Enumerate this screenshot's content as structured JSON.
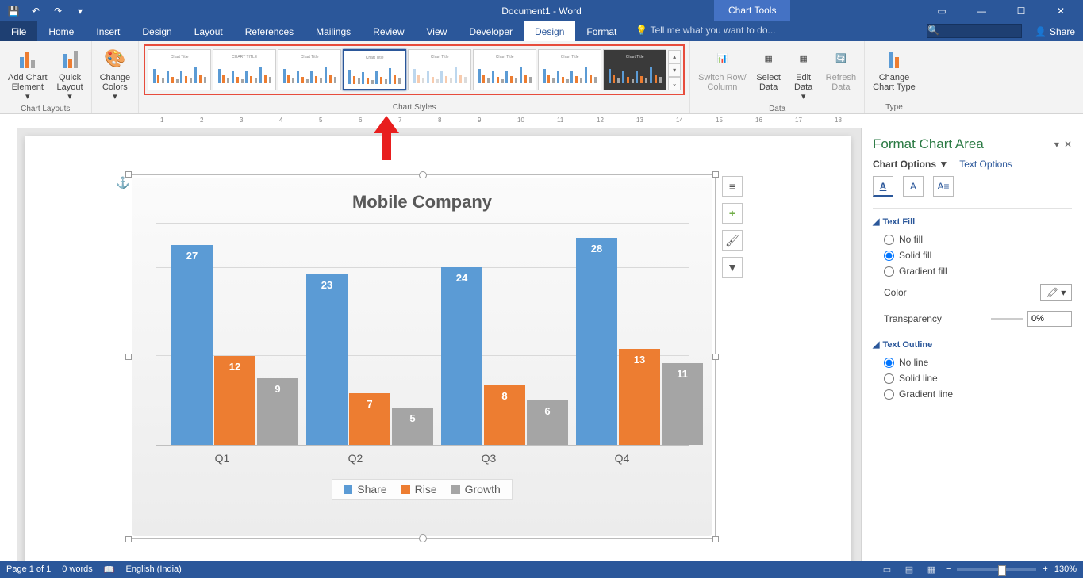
{
  "titlebar": {
    "doc_title": "Document1 - Word",
    "chart_tools": "Chart Tools"
  },
  "tabs": {
    "file": "File",
    "home": "Home",
    "insert": "Insert",
    "design_page": "Design",
    "layout": "Layout",
    "references": "References",
    "mailings": "Mailings",
    "review": "Review",
    "view": "View",
    "developer": "Developer",
    "design": "Design",
    "format": "Format",
    "tell_me": "Tell me what you want to do...",
    "share": "Share"
  },
  "ribbon": {
    "chart_layouts": "Chart Layouts",
    "add_chart_element": "Add Chart\nElement",
    "quick_layout": "Quick\nLayout",
    "change_colors": "Change\nColors",
    "chart_styles": "Chart Styles",
    "switch_rc": "Switch Row/\nColumn",
    "select_data": "Select\nData",
    "edit_data": "Edit\nData",
    "refresh_data": "Refresh\nData",
    "data": "Data",
    "change_chart_type": "Change\nChart Type",
    "type": "Type"
  },
  "chart_data": {
    "type": "bar",
    "title": "Mobile Company",
    "categories": [
      "Q1",
      "Q2",
      "Q3",
      "Q4"
    ],
    "series": [
      {
        "name": "Share",
        "color": "#5b9bd5",
        "values": [
          27,
          23,
          24,
          28
        ]
      },
      {
        "name": "Rise",
        "color": "#ed7d31",
        "values": [
          12,
          7,
          8,
          13
        ]
      },
      {
        "name": "Growth",
        "color": "#a5a5a5",
        "values": [
          9,
          5,
          6,
          11
        ]
      }
    ],
    "ylim": [
      0,
      30
    ]
  },
  "format_pane": {
    "title": "Format Chart Area",
    "chart_options": "Chart Options",
    "text_options": "Text Options",
    "text_fill": "Text Fill",
    "no_fill": "No fill",
    "solid_fill": "Solid fill",
    "gradient_fill": "Gradient fill",
    "color": "Color",
    "transparency": "Transparency",
    "transparency_val": "0%",
    "text_outline": "Text Outline",
    "no_line": "No line",
    "solid_line": "Solid line",
    "gradient_line": "Gradient line"
  },
  "statusbar": {
    "page": "Page 1 of 1",
    "words": "0 words",
    "lang": "English (India)",
    "zoom": "130%"
  },
  "side_buttons": {
    "layout": "layout",
    "plus": "+",
    "brush": "brush",
    "filter": "filter"
  }
}
